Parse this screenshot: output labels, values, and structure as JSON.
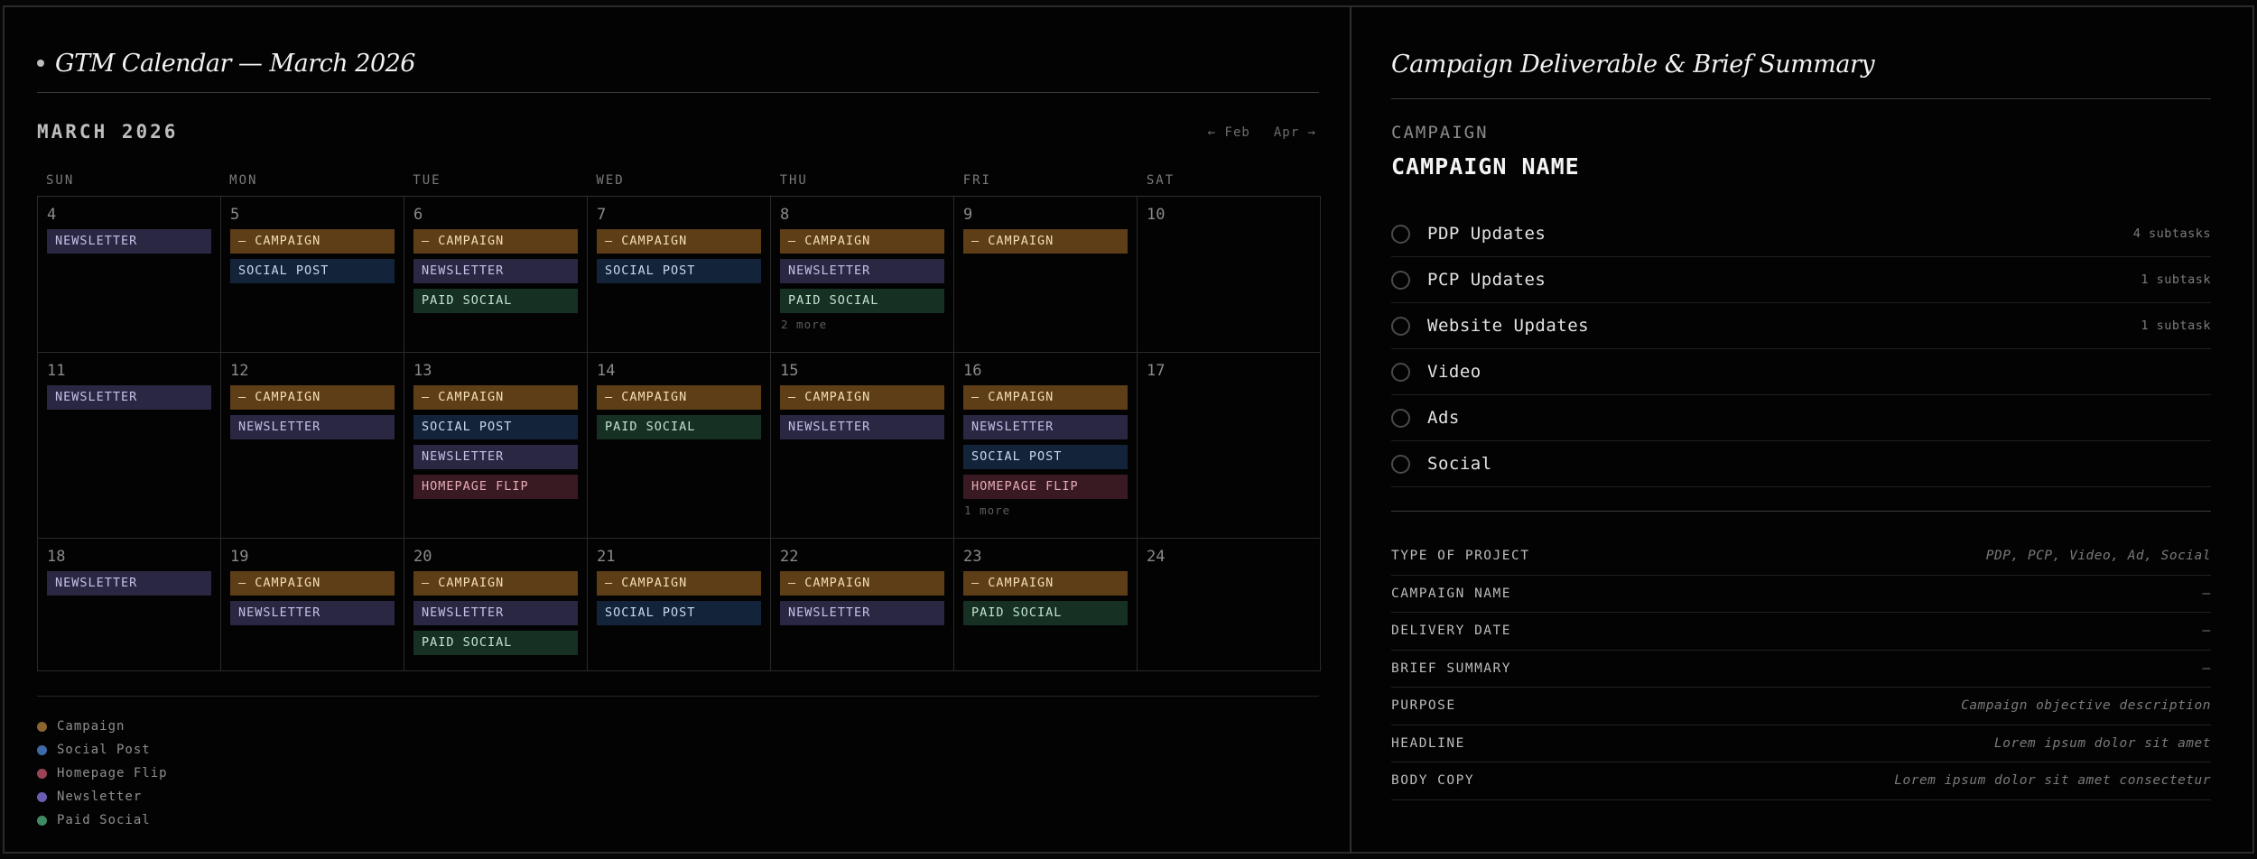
{
  "calendar": {
    "title": "GTM Calendar — March 2026",
    "month": "MARCH 2026",
    "nav_prev": "← Feb",
    "nav_next": "Apr →",
    "weekdays": [
      "SUN",
      "MON",
      "TUE",
      "WED",
      "THU",
      "FRI",
      "SAT"
    ],
    "weeks": [
      [
        {
          "day": "4",
          "events": [
            {
              "type": "newsletter",
              "label": "NEWSLETTER"
            }
          ]
        },
        {
          "day": "5",
          "events": [
            {
              "type": "campaign",
              "label": "— CAMPAIGN"
            },
            {
              "type": "social",
              "label": "SOCIAL POST"
            }
          ]
        },
        {
          "day": "6",
          "events": [
            {
              "type": "campaign",
              "label": "— CAMPAIGN"
            },
            {
              "type": "newsletter",
              "label": "NEWSLETTER"
            },
            {
              "type": "paid",
              "label": "PAID SOCIAL"
            }
          ]
        },
        {
          "day": "7",
          "events": [
            {
              "type": "campaign",
              "label": "— CAMPAIGN"
            },
            {
              "type": "social",
              "label": "SOCIAL POST"
            }
          ]
        },
        {
          "day": "8",
          "events": [
            {
              "type": "campaign",
              "label": "— CAMPAIGN"
            },
            {
              "type": "newsletter",
              "label": "NEWSLETTER"
            },
            {
              "type": "paid",
              "label": "PAID SOCIAL"
            }
          ],
          "more": "2 more"
        },
        {
          "day": "9",
          "events": [
            {
              "type": "campaign",
              "label": "— CAMPAIGN"
            }
          ]
        },
        {
          "day": "10",
          "events": []
        }
      ],
      [
        {
          "day": "11",
          "events": [
            {
              "type": "newsletter",
              "label": "NEWSLETTER"
            }
          ]
        },
        {
          "day": "12",
          "events": [
            {
              "type": "campaign",
              "label": "— CAMPAIGN"
            },
            {
              "type": "newsletter",
              "label": "NEWSLETTER"
            }
          ]
        },
        {
          "day": "13",
          "events": [
            {
              "type": "campaign",
              "label": "— CAMPAIGN"
            },
            {
              "type": "social",
              "label": "SOCIAL POST"
            },
            {
              "type": "newsletter",
              "label": "NEWSLETTER"
            },
            {
              "type": "flip",
              "label": "HOMEPAGE FLIP"
            }
          ]
        },
        {
          "day": "14",
          "events": [
            {
              "type": "campaign",
              "label": "— CAMPAIGN"
            },
            {
              "type": "paid",
              "label": "PAID SOCIAL"
            }
          ]
        },
        {
          "day": "15",
          "events": [
            {
              "type": "campaign",
              "label": "— CAMPAIGN"
            },
            {
              "type": "newsletter",
              "label": "NEWSLETTER"
            }
          ]
        },
        {
          "day": "16",
          "events": [
            {
              "type": "campaign",
              "label": "— CAMPAIGN"
            },
            {
              "type": "newsletter",
              "label": "NEWSLETTER"
            },
            {
              "type": "social",
              "label": "SOCIAL POST"
            },
            {
              "type": "flip",
              "label": "HOMEPAGE FLIP"
            }
          ],
          "more": "1 more"
        },
        {
          "day": "17",
          "events": []
        }
      ],
      [
        {
          "day": "18",
          "events": [
            {
              "type": "newsletter",
              "label": "NEWSLETTER"
            }
          ]
        },
        {
          "day": "19",
          "events": [
            {
              "type": "campaign",
              "label": "— CAMPAIGN"
            },
            {
              "type": "newsletter",
              "label": "NEWSLETTER"
            }
          ]
        },
        {
          "day": "20",
          "events": [
            {
              "type": "campaign",
              "label": "— CAMPAIGN"
            },
            {
              "type": "newsletter",
              "label": "NEWSLETTER"
            },
            {
              "type": "paid",
              "label": "PAID SOCIAL"
            }
          ]
        },
        {
          "day": "21",
          "events": [
            {
              "type": "campaign",
              "label": "— CAMPAIGN"
            },
            {
              "type": "social",
              "label": "SOCIAL POST"
            }
          ]
        },
        {
          "day": "22",
          "events": [
            {
              "type": "campaign",
              "label": "— CAMPAIGN"
            },
            {
              "type": "newsletter",
              "label": "NEWSLETTER"
            }
          ]
        },
        {
          "day": "23",
          "events": [
            {
              "type": "campaign",
              "label": "— CAMPAIGN"
            },
            {
              "type": "paid",
              "label": "PAID SOCIAL"
            }
          ]
        },
        {
          "day": "24",
          "events": []
        }
      ]
    ],
    "legend": [
      {
        "label": "Campaign",
        "color": "#8a6530"
      },
      {
        "label": "Social Post",
        "color": "#3e6aa8"
      },
      {
        "label": "Homepage Flip",
        "color": "#9c4456"
      },
      {
        "label": "Newsletter",
        "color": "#6a5db0"
      },
      {
        "label": "Paid Social",
        "color": "#3f8a63"
      }
    ]
  },
  "summary": {
    "title": "Campaign Deliverable & Brief Summary",
    "kicker": "CAMPAIGN",
    "name": "CAMPAIGN NAME",
    "tasks": [
      {
        "label": "PDP Updates",
        "meta": "4 subtasks"
      },
      {
        "label": "PCP Updates",
        "meta": "1 subtask"
      },
      {
        "label": "Website Updates",
        "meta": "1 subtask"
      },
      {
        "label": "Video",
        "meta": ""
      },
      {
        "label": "Ads",
        "meta": ""
      },
      {
        "label": "Social",
        "meta": ""
      }
    ],
    "fields": [
      {
        "label": "TYPE OF PROJECT",
        "value": "PDP, PCP, Video, Ad, Social"
      },
      {
        "label": "CAMPAIGN NAME",
        "value": "—"
      },
      {
        "label": "DELIVERY DATE",
        "value": "—"
      },
      {
        "label": "BRIEF SUMMARY",
        "value": "—"
      },
      {
        "label": "PURPOSE",
        "value": "Campaign objective description"
      },
      {
        "label": "HEADLINE",
        "value": "Lorem ipsum dolor sit amet"
      },
      {
        "label": "BODY COPY",
        "value": "Lorem ipsum dolor sit amet consectetur"
      }
    ]
  }
}
